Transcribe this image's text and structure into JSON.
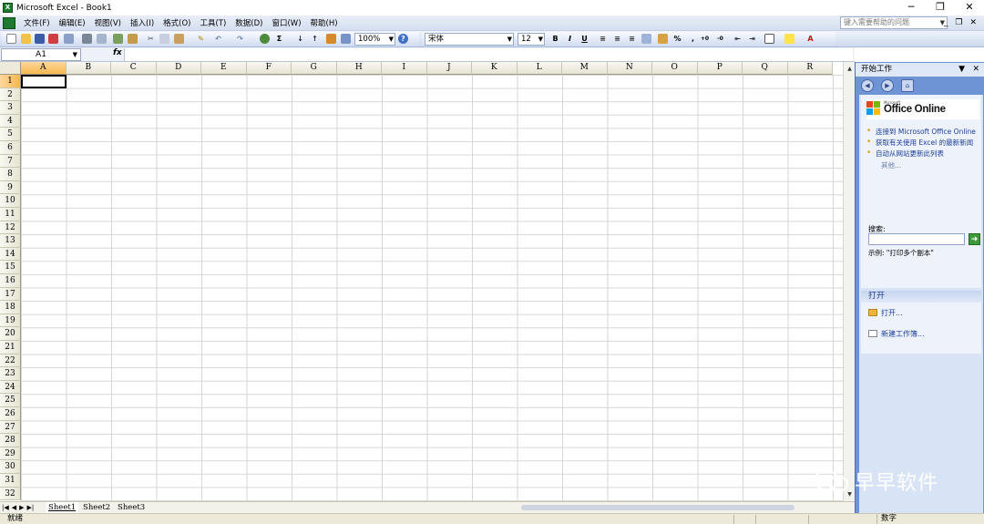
{
  "window": {
    "title": "Microsoft Excel - Book1",
    "app_icon_glyph": "X",
    "controls": [
      "─",
      "❐",
      "✕"
    ]
  },
  "menu": {
    "items": [
      "文件(F)",
      "编辑(E)",
      "视图(V)",
      "插入(I)",
      "格式(O)",
      "工具(T)",
      "数据(D)",
      "窗口(W)",
      "帮助(H)"
    ],
    "help_placeholder": "键入需要帮助的问题",
    "doc_controls": [
      "_",
      "❐",
      "✕"
    ]
  },
  "toolbar": {
    "zoom": "100%",
    "font_name": "宋体",
    "font_size": "12",
    "bold": "B",
    "italic": "I",
    "underline": "U",
    "sum": "Σ",
    "percent": "%",
    "comma": ","
  },
  "formula_bar": {
    "name_box": "A1",
    "fx": "fx",
    "formula": ""
  },
  "grid": {
    "columns": [
      "A",
      "B",
      "C",
      "D",
      "E",
      "F",
      "G",
      "H",
      "I",
      "J",
      "K",
      "L",
      "M",
      "N",
      "O",
      "P",
      "Q",
      "R"
    ],
    "rows": [
      "1",
      "2",
      "3",
      "4",
      "5",
      "6",
      "7",
      "8",
      "9",
      "10",
      "11",
      "12",
      "13",
      "14",
      "15",
      "16",
      "17",
      "18",
      "19",
      "20",
      "21",
      "22",
      "23",
      "24",
      "25",
      "26",
      "27",
      "28",
      "29",
      "30",
      "31",
      "32"
    ],
    "active_column": "A",
    "active_row": "1"
  },
  "sheets": {
    "tabs": [
      "Sheet1",
      "Sheet2",
      "Sheet3"
    ],
    "active": "Sheet1",
    "nav": [
      "|◀",
      "◀",
      "▶",
      "▶|"
    ]
  },
  "statusbar": {
    "ready": "就绪",
    "num": "数字"
  },
  "taskpane": {
    "title": "开始工作",
    "office_brand": "Microsoft",
    "office_word": "Office Online",
    "links": [
      "连接到 Microsoft Office Online",
      "获取有关使用 Excel 的最新新闻",
      "自动从网站更新此列表"
    ],
    "more": "其他...",
    "search_label": "搜索:",
    "search_go": "➜",
    "example": "示例: \"打印多个副本\"",
    "open_header": "打开",
    "open_action": "打开...",
    "new_action": "新建工作簿..."
  },
  "watermark": {
    "text": "早早软件"
  }
}
